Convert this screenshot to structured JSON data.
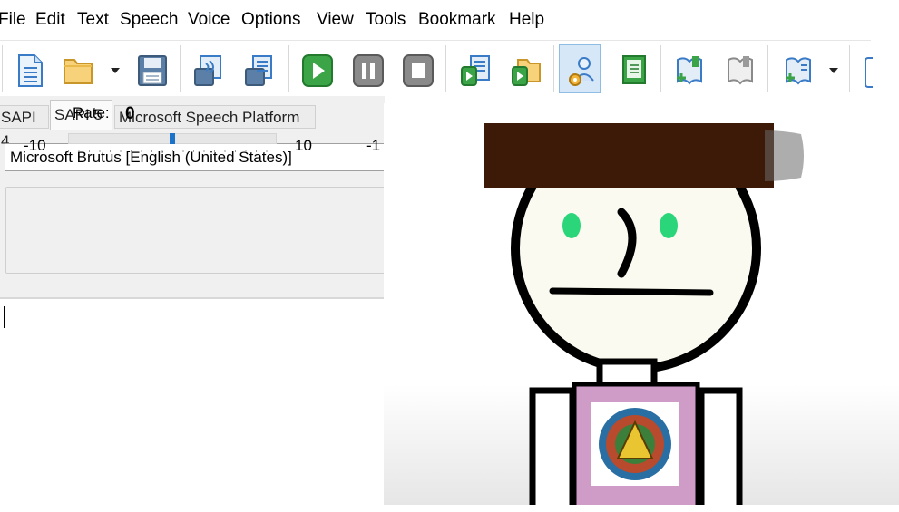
{
  "menu": {
    "items": [
      "File",
      "Edit",
      "Text",
      "Speech",
      "Voice",
      "Options",
      "View",
      "Tools",
      "Bookmark",
      "Help"
    ]
  },
  "toolbar": {
    "icons": [
      "new-document-icon",
      "open-folder-icon",
      "save-icon",
      "save-audio-icon",
      "split-audio-icon",
      "play-icon",
      "pause-icon",
      "stop-icon",
      "read-aloud-icon",
      "open-read-icon",
      "voice-settings-icon",
      "text-edit-icon",
      "add-bookmark-icon",
      "bookmark-icon",
      "bookmark-list-icon"
    ],
    "accent": "#2f9e3a"
  },
  "tabs": [
    "SAPI 4",
    "SAPI 5",
    "Microsoft Speech Platform"
  ],
  "active_tab": "SAPI 5",
  "voice": {
    "selected": "Microsoft Brutus [English (United States)]"
  },
  "rate": {
    "label": "Rate:",
    "value": "0",
    "min": "-10",
    "max": "10",
    "next_min": "-1"
  },
  "colors": {
    "slider_thumb": "#1a73c9",
    "hat": "#3d1a08",
    "eyes": "#2bd67b",
    "shirt": "#cf9cc8"
  }
}
